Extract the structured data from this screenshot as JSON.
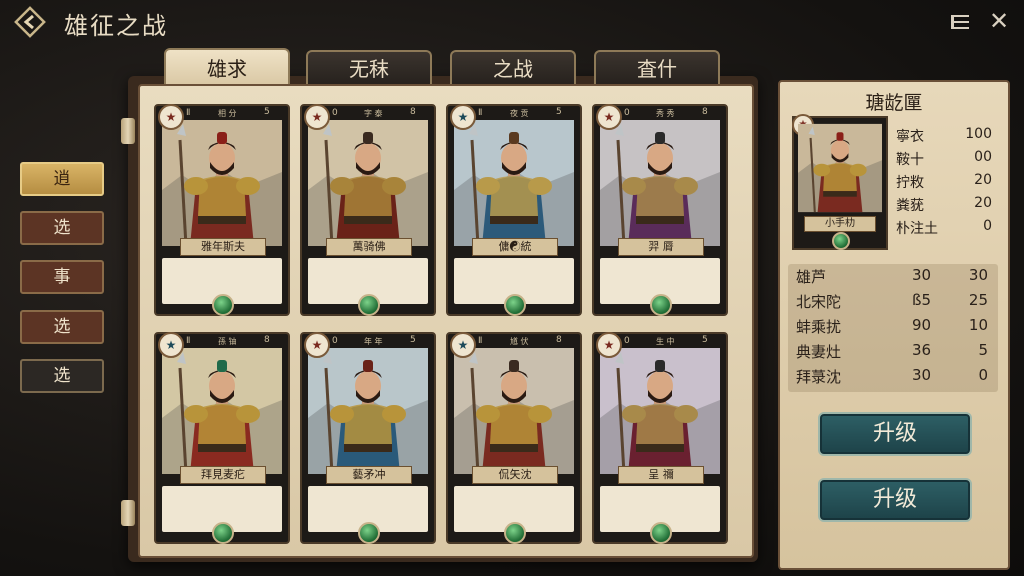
{
  "header": {
    "title": "雄征之战"
  },
  "tabs": [
    "雄求",
    "无秣",
    "之战",
    "査什"
  ],
  "side_buttons": [
    "逍",
    "选",
    "事",
    "选",
    "选"
  ],
  "cards": [
    {
      "rank": "★",
      "stat_a": "Ⅱ",
      "stat_b": "相 分",
      "stat_c": "5",
      "name": "雅年斯夫",
      "bg": "#c9b89a",
      "armor": "#7a2a20",
      "accent": "#b8943a",
      "hat": "#8a1f18",
      "rank_style": ""
    },
    {
      "rank": "★",
      "stat_a": "0",
      "stat_b": "字 泰",
      "stat_c": "8",
      "name": "萬骑佛",
      "bg": "#d1c3a6",
      "armor": "#6a2218",
      "accent": "#a8843a",
      "hat": "#3a2a20",
      "rank_style": ""
    },
    {
      "rank": "★",
      "stat_a": "Ⅱ",
      "stat_b": "夜 贡",
      "stat_c": "5",
      "name": "傭☯統",
      "bg": "#b8c6cc",
      "armor": "#2c5a7a",
      "accent": "#b89a4a",
      "hat": "#5a3a20",
      "rank_style": "blue"
    },
    {
      "rank": "★",
      "stat_a": "0",
      "stat_b": "秀 秀",
      "stat_c": "8",
      "name": "羿  脣",
      "bg": "#c6c2c4",
      "armor": "#5a2c5a",
      "accent": "#a88a4a",
      "hat": "#2a2a2a",
      "rank_style": ""
    },
    {
      "rank": "★",
      "stat_a": "Ⅱ",
      "stat_b": "孫 铀",
      "stat_c": "8",
      "name": "拜見麦疕",
      "bg": "#d3c7a4",
      "armor": "#8a2a20",
      "accent": "#b8943a",
      "hat": "#1f6a4a",
      "rank_style": "blue"
    },
    {
      "rank": "★",
      "stat_a": "0",
      "stat_b": "年 年",
      "stat_c": "5",
      "name": "藝矛冲",
      "bg": "#b9c6ca",
      "armor": "#2a5a7a",
      "accent": "#b8943a",
      "hat": "#6a2218",
      "rank_style": ""
    },
    {
      "rank": "★",
      "stat_a": "Ⅱ",
      "stat_b": "馗 伏",
      "stat_c": "8",
      "name": "侃矢沈",
      "bg": "#c9bfae",
      "armor": "#7a2a20",
      "accent": "#b8943a",
      "hat": "#3a2a20",
      "rank_style": "blue"
    },
    {
      "rank": "★",
      "stat_a": "0",
      "stat_b": "生 中",
      "stat_c": "5",
      "name": "呈  禰",
      "bg": "#c9c0cc",
      "armor": "#6a2030",
      "accent": "#a88a4a",
      "hat": "#2a2a2a",
      "rank_style": ""
    }
  ],
  "detail": {
    "title": "瑭龁匰",
    "portrait_name": "小手朸",
    "portrait_rank": "★",
    "attributes": [
      {
        "k": "寧衣",
        "v": "100"
      },
      {
        "k": "鞍十",
        "v": "00"
      },
      {
        "k": "拧敉",
        "v": "20"
      },
      {
        "k": "粪莸",
        "v": "20"
      },
      {
        "k": "朴注土",
        "v": "0"
      }
    ],
    "stats": [
      {
        "n": "雄芦",
        "a": "30",
        "b": "30"
      },
      {
        "n": "北宋陀",
        "a": "ß5",
        "b": "25"
      },
      {
        "n": "蚌乘扰",
        "a": "90",
        "b": "10"
      },
      {
        "n": "典妻灶",
        "a": "36",
        "b": "5"
      },
      {
        "n": "拜菉沈",
        "a": "30",
        "b": "0"
      }
    ],
    "upgrade_label": "升级",
    "upgrade_label_2": "升级"
  },
  "icons": {
    "back": "back-diamond-icon",
    "menu": "list-menu-icon",
    "close": "close-icon"
  },
  "colors": {
    "accent_teal": "#2e6066",
    "gold": "#d9b466",
    "parchment": "#e9dcc0"
  }
}
